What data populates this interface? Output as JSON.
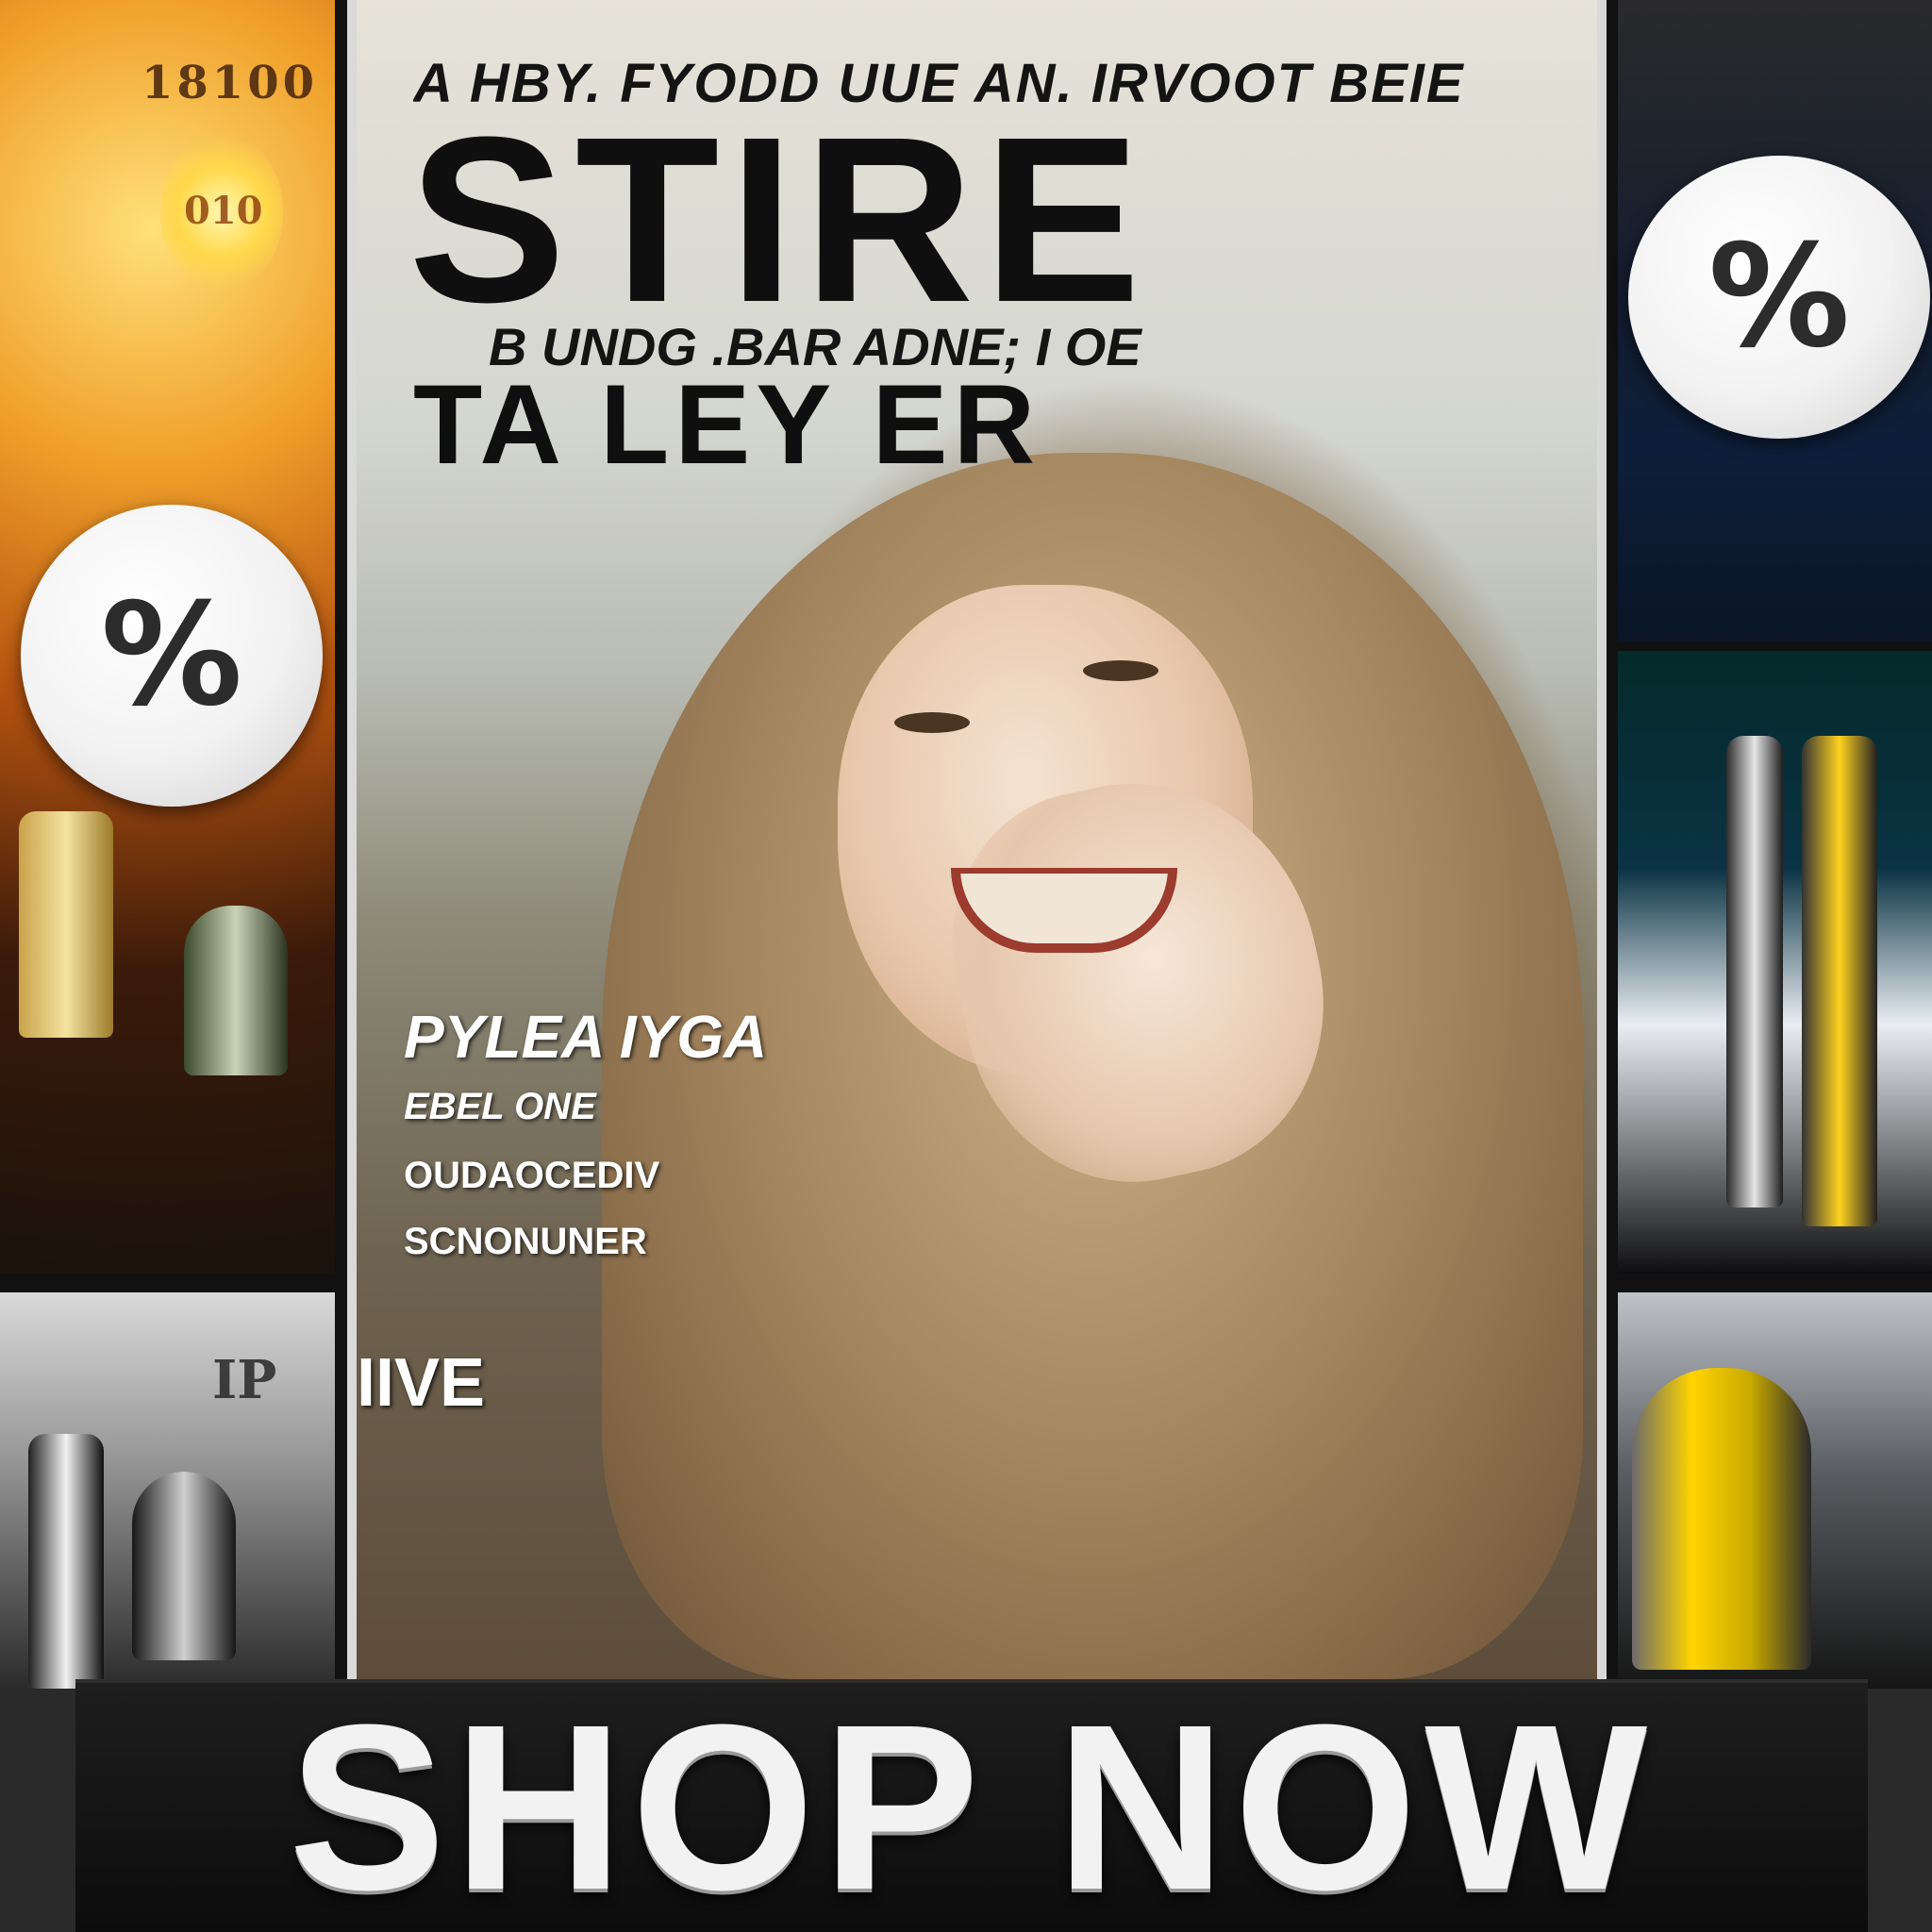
{
  "left_panel": {
    "shelf_text_top": "18100",
    "shelf_text_glow": "010",
    "shelf_text_bottom": "IP"
  },
  "badges": {
    "left_symbol": "%",
    "right_symbol": "%"
  },
  "cover": {
    "kicker": "A HBY. FYODD UUE AN. IRVOOT BEIE",
    "masthead": "STIRE",
    "subline": "B UNDG .BAR ADNE; I OE",
    "headline2": "TA LEY ER",
    "blurb": {
      "line1": "PYLEA IYGA",
      "line2": "EBEL ONE",
      "line3": "OUDAOCEDIV",
      "line4": "SCNONUNER"
    },
    "tag": "IIVE"
  },
  "cta": {
    "label": "SHOP NOW"
  },
  "icons": {
    "badge_icon": "percent-icon"
  }
}
